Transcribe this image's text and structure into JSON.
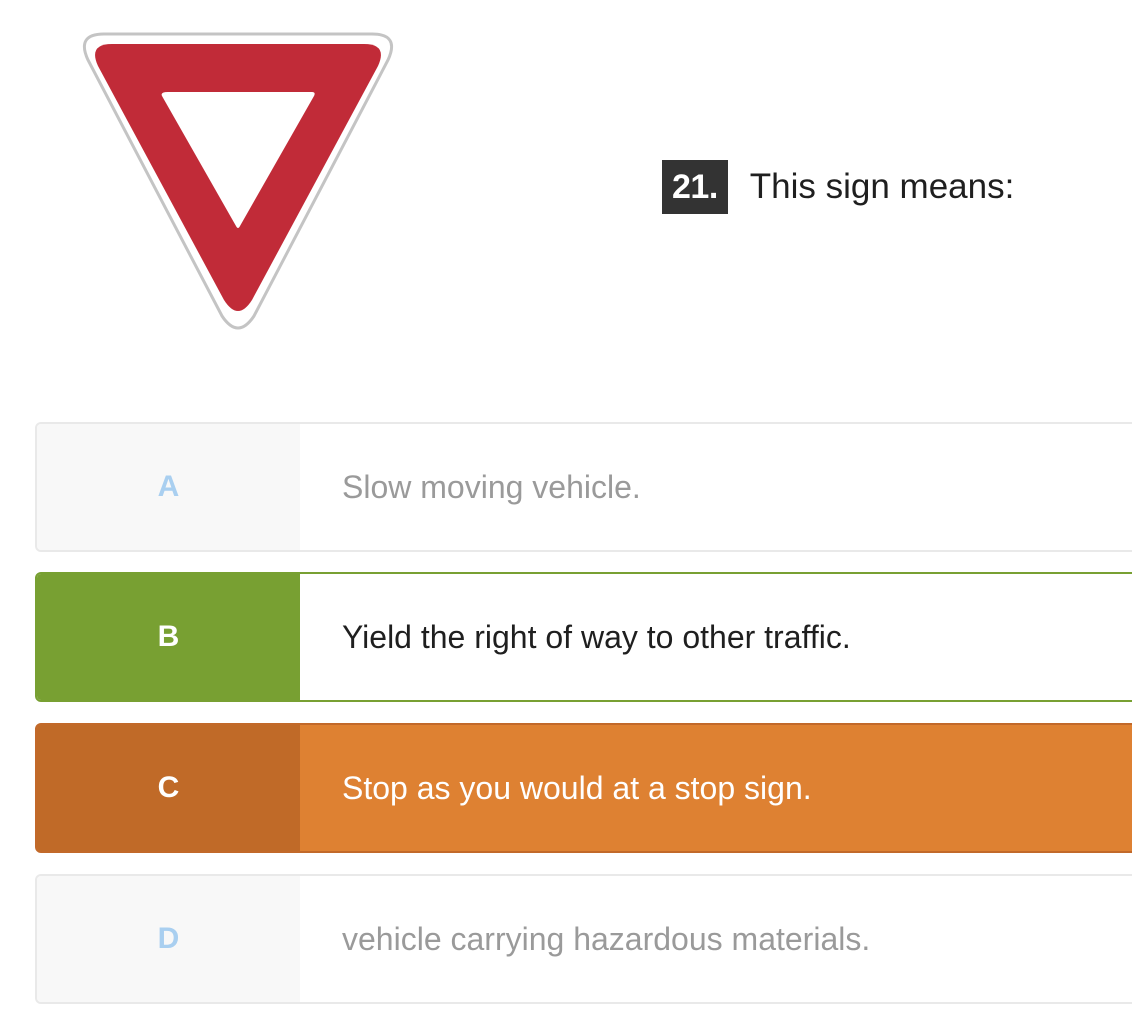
{
  "sign": {
    "icon": "yield-sign-icon",
    "colors": {
      "red": "#c12b38",
      "white": "#ffffff",
      "border": "#c4c4c4"
    }
  },
  "question": {
    "number": "21.",
    "text": "This sign means:"
  },
  "options": [
    {
      "letter": "A",
      "text": "Slow moving vehicle.",
      "state": "default"
    },
    {
      "letter": "B",
      "text": "Yield the right of way to other traffic.",
      "state": "correct"
    },
    {
      "letter": "C",
      "text": "Stop as you would at a stop sign.",
      "state": "selected-incorrect"
    },
    {
      "letter": "D",
      "text": "vehicle carrying hazardous materials.",
      "state": "default"
    }
  ],
  "colors": {
    "correct": "#78a032",
    "incorrect": "#de8132",
    "incorrect_dark": "#c06a28",
    "default_letter": "#a9cff0",
    "default_text": "#9a9a9a"
  }
}
